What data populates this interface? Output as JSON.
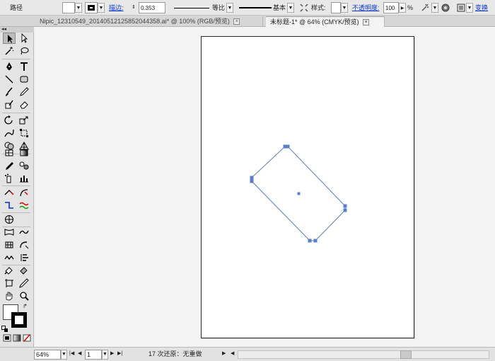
{
  "control_bar": {
    "object_type": "路径",
    "stroke_label": "描边:",
    "stroke_weight": "0.353",
    "profile_label": "等比",
    "brush_label": "基本",
    "style_label": "样式:",
    "opacity_label": "不透明度:",
    "opacity_value": "100",
    "opacity_unit": "%",
    "transform_label": "变换"
  },
  "tabs": [
    {
      "label": "Nipic_12310549_20140512125852044358.ai* @ 100% (RGB/预览)",
      "close": "×"
    },
    {
      "label": "未标题-1* @ 64% (CMYK/预览)",
      "close": "×"
    }
  ],
  "tools_panel": {
    "grip": "◂◂"
  },
  "status_bar": {
    "zoom": "64%",
    "artboard_number": "1",
    "status_text": "17 次还原：无重做",
    "arrow_right": "▶",
    "arrow_left": "◀",
    "nav_first": "|◀",
    "nav_prev": "◀",
    "nav_next": "▶",
    "nav_last": "▶|"
  },
  "colors": {
    "selection": "#5b7fc4",
    "link": "#0b35d8"
  }
}
